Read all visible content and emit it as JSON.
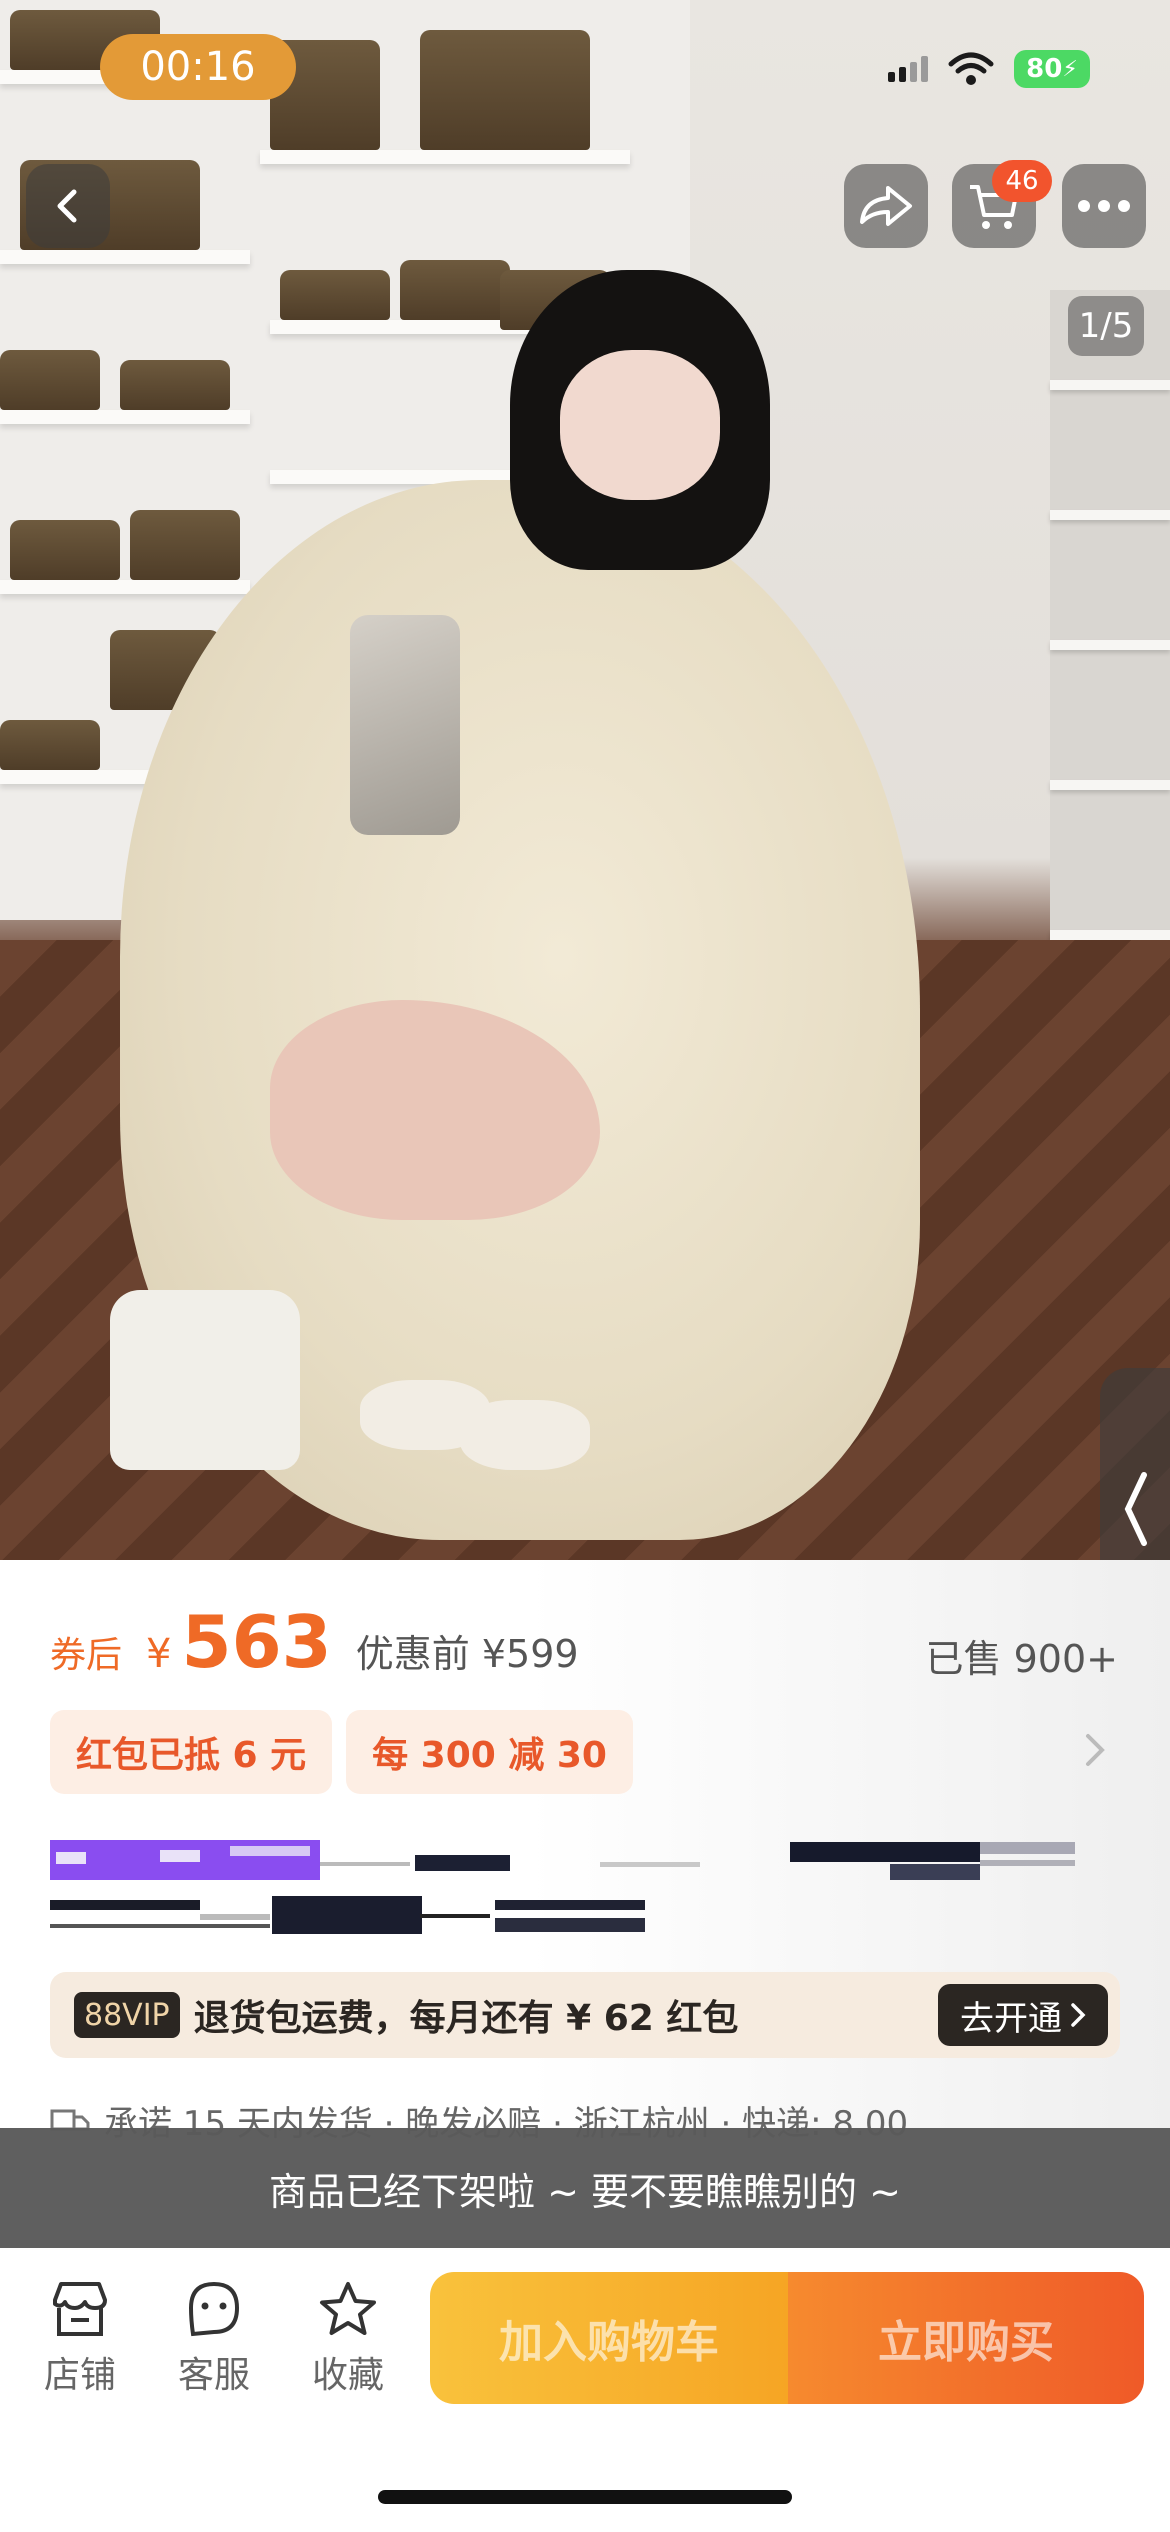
{
  "status_bar": {
    "timer": "00:16",
    "battery": "80"
  },
  "top_nav": {
    "back_icon": "chevron-left-icon",
    "share_icon": "share-icon",
    "cart_icon": "cart-icon",
    "cart_count": "46",
    "more_icon": "more-icon"
  },
  "gallery": {
    "counter": "1/5"
  },
  "price": {
    "after_label": "券后",
    "currency": "¥",
    "value": "563",
    "before_text": "优惠前 ¥599",
    "sold_text": "已售 900+"
  },
  "coupons": [
    "红包已抵 6 元",
    "每 300 减 30"
  ],
  "vip": {
    "badge": "88VIP",
    "text": "退货包运费，每月还有 ¥ 62 红包",
    "button": "去开通"
  },
  "promise": {
    "text": "承诺 15 天内发货 · 晚发必赔 · 浙江杭州 · 快递: 8.00"
  },
  "toast": {
    "text": "商品已经下架啦 ~ 要不要瞧瞧别的 ~"
  },
  "bottom_bar": {
    "shop": "店铺",
    "service": "客服",
    "favorite": "收藏",
    "add_to_cart": "加入购物车",
    "buy_now": "立即购买"
  },
  "colors": {
    "accent": "#ef6a26",
    "cart_button": "#f6a524",
    "buy_button": "#ef5a28",
    "vip_dark": "#2b2622"
  }
}
